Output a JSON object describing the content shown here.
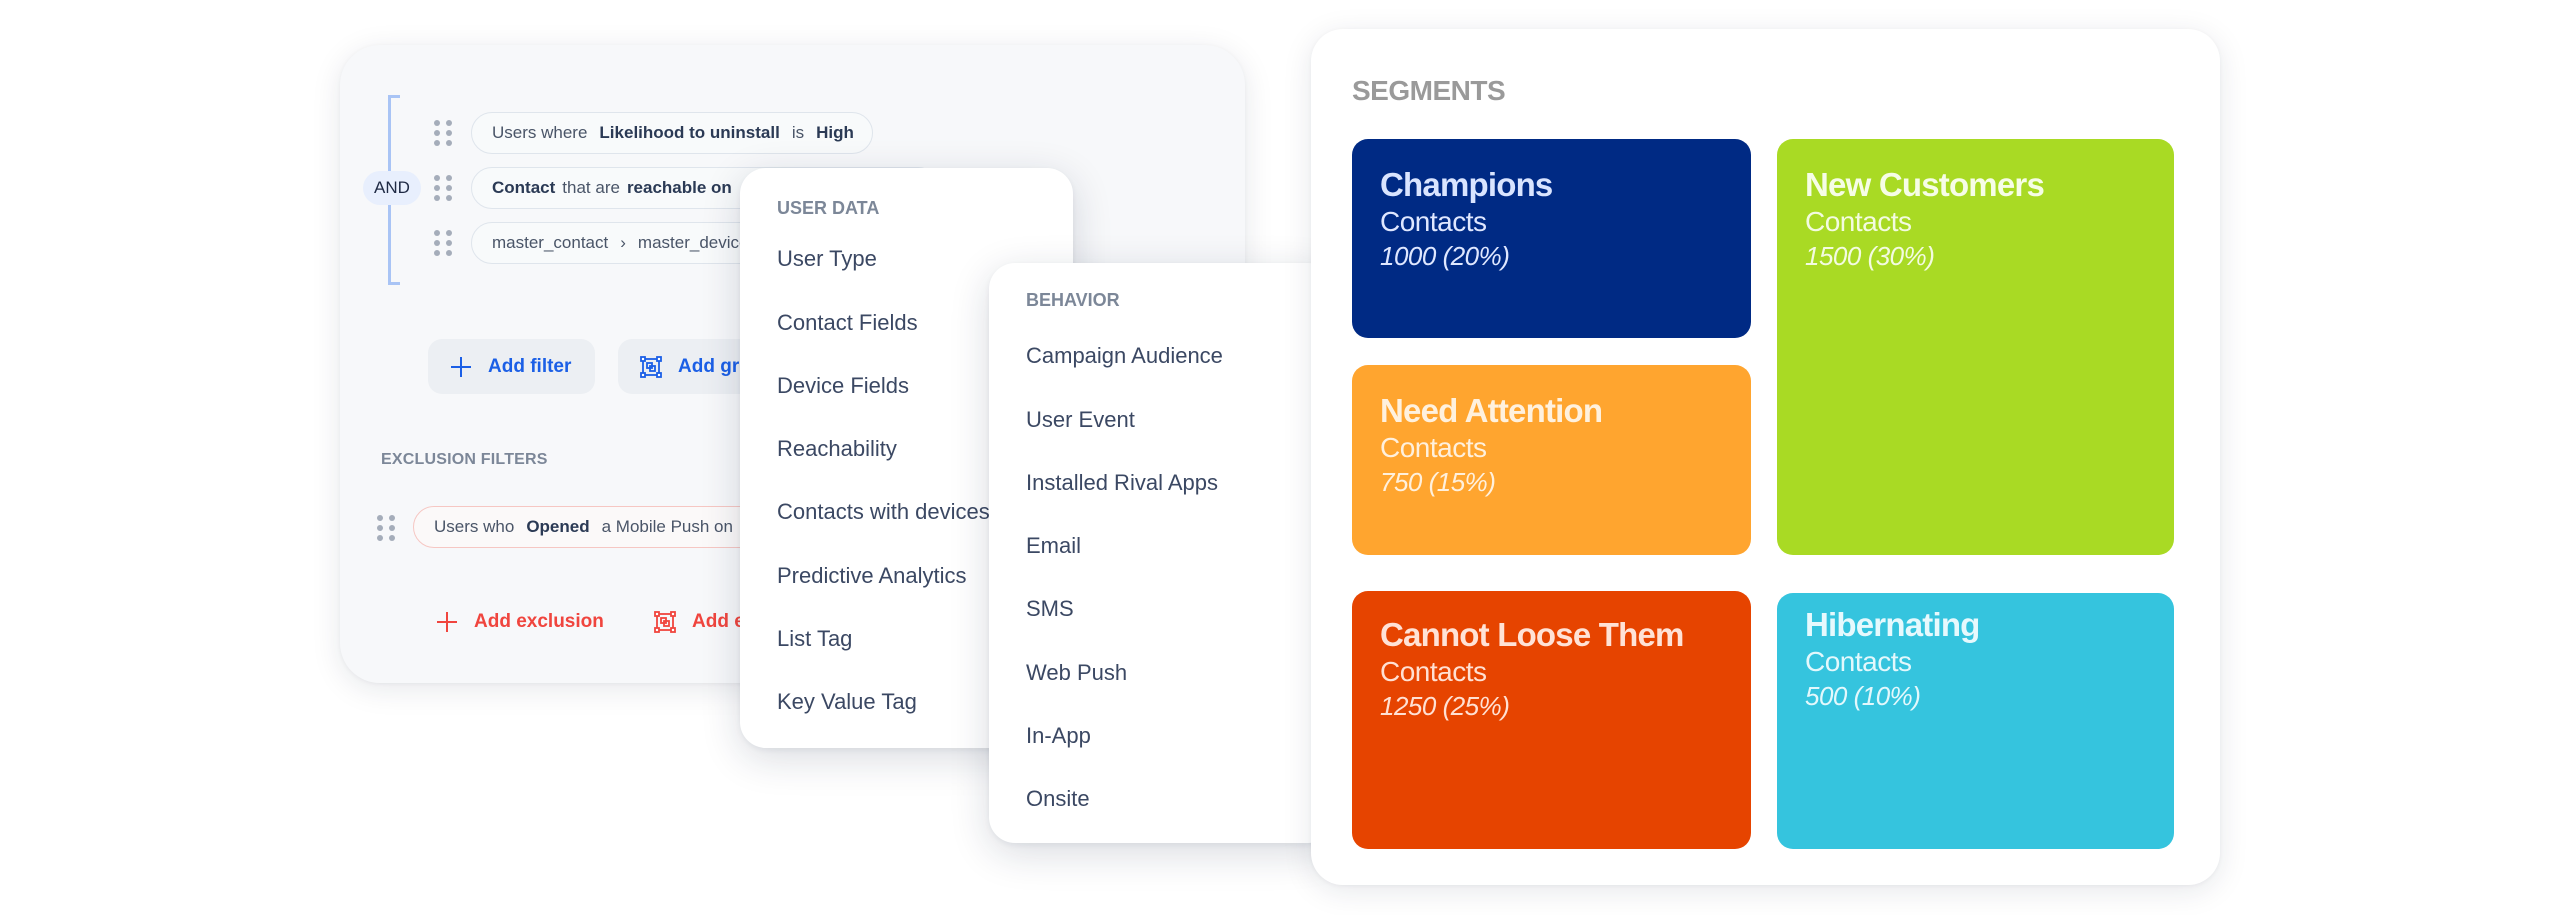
{
  "filters": {
    "operator": "AND",
    "rows": [
      {
        "parts": [
          {
            "text": "Users where",
            "bold": false
          },
          {
            "text": "Likelihood to uninstall",
            "bold": true
          },
          {
            "text": "is",
            "bold": false
          },
          {
            "text": "High",
            "bold": true
          }
        ]
      },
      {
        "parts": [
          {
            "text": "Contact",
            "bold": true
          },
          {
            "text": "that are",
            "bold": false
          },
          {
            "text": "reachable on",
            "bold": true
          }
        ]
      },
      {
        "parts": [
          {
            "text": "master_contact",
            "bold": false
          },
          {
            "text": "›",
            "bold": false
          },
          {
            "text": "master_device",
            "bold": false
          }
        ]
      }
    ],
    "add_filter_label": "Add filter",
    "add_group_label": "Add group"
  },
  "exclusion": {
    "heading": "EXCLUSION FILTERS",
    "row": {
      "parts": [
        {
          "text": "Users who",
          "bold": false
        },
        {
          "text": "Opened",
          "bold": true
        },
        {
          "text": "a Mobile Push on",
          "bold": false
        }
      ]
    },
    "add_exclusion_label": "Add exclusion",
    "add_exclusion_group_label": "Add exclusion group"
  },
  "user_data_menu": {
    "heading": "USER DATA",
    "items": [
      "User Type",
      "Contact Fields",
      "Device Fields",
      "Reachability",
      "Contacts with devices",
      "Predictive Analytics",
      "List Tag",
      "Key Value Tag"
    ]
  },
  "behavior_menu": {
    "heading": "BEHAVIOR",
    "items": [
      "Campaign Audience",
      "User Event",
      "Installed Rival Apps",
      "Email",
      "SMS",
      "Web Push",
      "In-App",
      "Onsite"
    ]
  },
  "segments": {
    "title": "SEGMENTS",
    "tiles": [
      {
        "name": "Champions",
        "label": "Contacts",
        "count": "1000 (20%)",
        "bg": "#002a84",
        "name_color": "#d9e4ff",
        "text_color": "#dfe7ff"
      },
      {
        "name": "New Customers",
        "label": "Contacts",
        "count": "1500 (30%)",
        "bg": "#a9da24",
        "name_color": "#f6fde6",
        "text_color": "#f3fbe0"
      },
      {
        "name": "Need Attention",
        "label": "Contacts",
        "count": "750 (15%)",
        "bg": "#ffa52f",
        "name_color": "#fff1de",
        "text_color": "#fff0dc"
      },
      {
        "name": "Cannot Loose Them",
        "label": "Contacts",
        "count": "1250 (25%)",
        "bg": "#e64400",
        "name_color": "#ffe2d6",
        "text_color": "#ffe0d3"
      },
      {
        "name": "Hibernating",
        "label": "Contacts",
        "count": "500 (10%)",
        "bg": "#35c4de",
        "name_color": "#e6f9fd",
        "text_color": "#e3f8fc"
      }
    ]
  },
  "colors": {
    "accent_blue": "#1b5fe6",
    "accent_red": "#f0453e"
  }
}
